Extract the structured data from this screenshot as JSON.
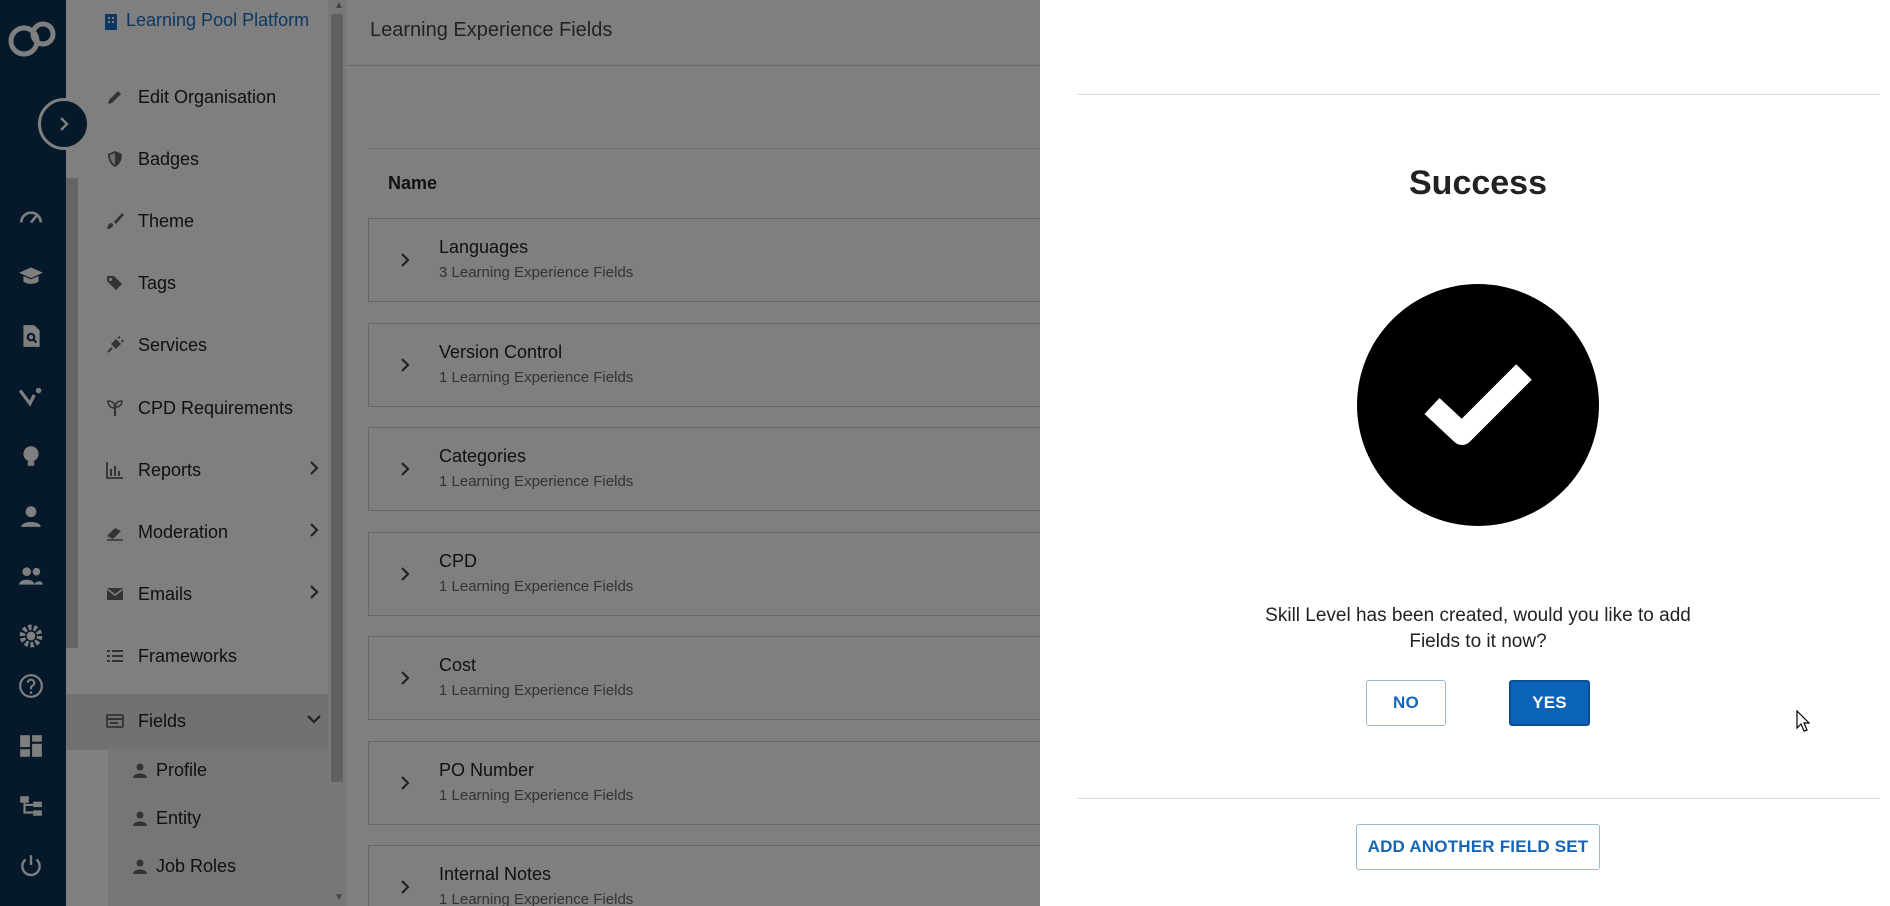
{
  "sidebar": {
    "org_name": "Learning Pool Platform",
    "items": [
      {
        "label": "Edit Organisation",
        "icon": "pencil-icon"
      },
      {
        "label": "Badges",
        "icon": "shield-icon"
      },
      {
        "label": "Theme",
        "icon": "brush-icon"
      },
      {
        "label": "Tags",
        "icon": "tags-icon"
      },
      {
        "label": "Services",
        "icon": "plug-icon"
      },
      {
        "label": "CPD Requirements",
        "icon": "seedling-icon"
      },
      {
        "label": "Reports",
        "icon": "chart-icon"
      },
      {
        "label": "Moderation",
        "icon": "eraser-icon"
      },
      {
        "label": "Emails",
        "icon": "envelope-icon"
      },
      {
        "label": "Frameworks",
        "icon": "list-icon"
      },
      {
        "label": "Fields",
        "icon": "card-icon"
      }
    ],
    "sub_items": [
      {
        "label": "Profile",
        "icon": "user-icon"
      },
      {
        "label": "Entity",
        "icon": "user-icon"
      },
      {
        "label": "Job Roles",
        "icon": "user-icon"
      }
    ]
  },
  "main": {
    "title": "Learning Experience Fields",
    "table_header": "Name",
    "rows": [
      {
        "name": "Languages",
        "sub": "3 Learning Experience Fields"
      },
      {
        "name": "Version Control",
        "sub": "1 Learning Experience Fields"
      },
      {
        "name": "Categories",
        "sub": "1 Learning Experience Fields"
      },
      {
        "name": "CPD",
        "sub": "1 Learning Experience Fields"
      },
      {
        "name": "Cost",
        "sub": "1 Learning Experience Fields"
      },
      {
        "name": "PO Number",
        "sub": "1 Learning Experience Fields"
      },
      {
        "name": "Internal Notes",
        "sub": "1 Learning Experience Fields"
      }
    ]
  },
  "dialog": {
    "title": "Success",
    "message": "Skill Level has been created, would you like to add Fields to it now?",
    "no_label": "NO",
    "yes_label": "YES",
    "add_another_label": "ADD ANOTHER FIELD SET"
  },
  "colors": {
    "rail": "#0c3354",
    "primary": "#0a63b8",
    "link": "#1a6fc0"
  }
}
